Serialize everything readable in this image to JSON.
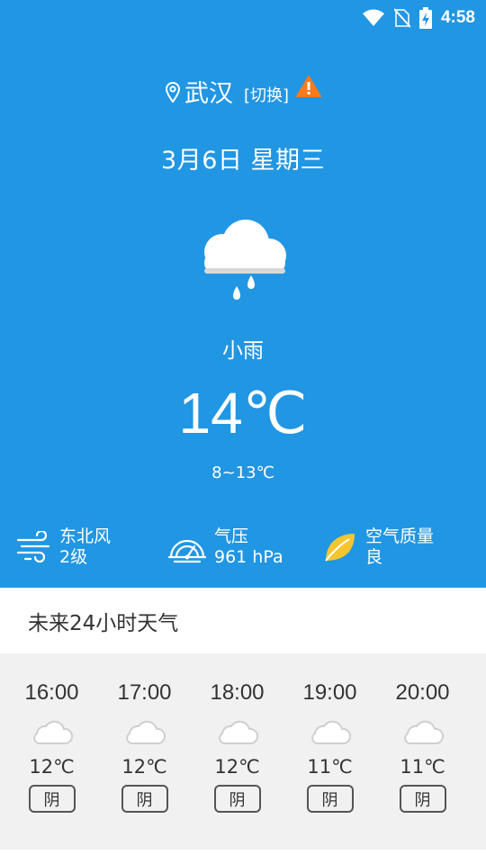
{
  "status": {
    "time": "4:58"
  },
  "location": {
    "city": "武汉",
    "switch_label": "[切换]"
  },
  "date": {
    "text": "3月6日  星期三"
  },
  "current": {
    "condition": "小雨",
    "temperature": "14℃",
    "range": "8~13℃"
  },
  "metrics": {
    "wind": {
      "line1": "东北风",
      "line2": "2级"
    },
    "pressure": {
      "line1": "气压",
      "line2": "961 hPa"
    },
    "air": {
      "line1": "空气质量",
      "line2": "良"
    }
  },
  "future": {
    "title": "未来24小时天气"
  },
  "hourly": [
    {
      "time": "16:00",
      "temp": "12℃",
      "desc": "阴"
    },
    {
      "time": "17:00",
      "temp": "12℃",
      "desc": "阴"
    },
    {
      "time": "18:00",
      "temp": "12℃",
      "desc": "阴"
    },
    {
      "time": "19:00",
      "temp": "11℃",
      "desc": "阴"
    },
    {
      "time": "20:00",
      "temp": "11℃",
      "desc": "阴"
    }
  ],
  "colors": {
    "primary": "#2196e3",
    "warning": "#ff7a1a",
    "air_good": "#f7c62f",
    "hourly_bg": "#f1f1f1"
  }
}
